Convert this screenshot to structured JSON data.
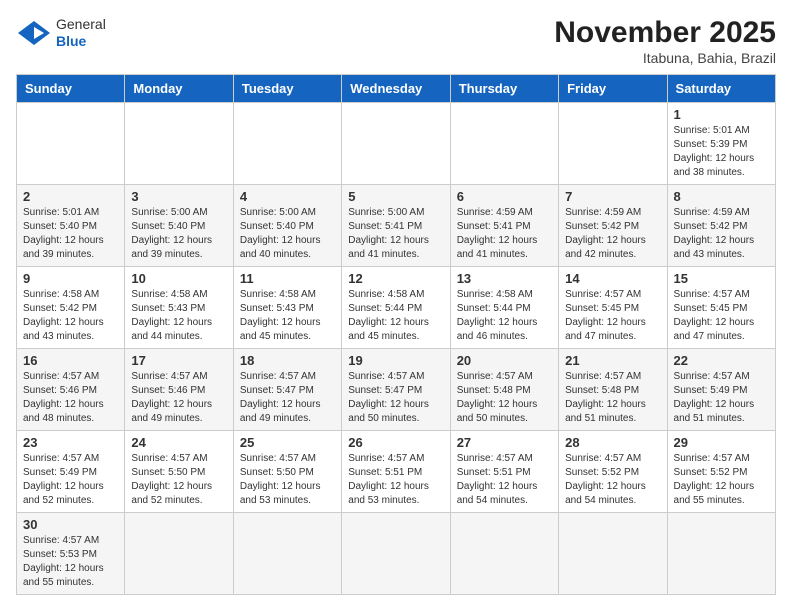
{
  "header": {
    "logo_general": "General",
    "logo_blue": "Blue",
    "month_title": "November 2025",
    "location": "Itabuna, Bahia, Brazil"
  },
  "weekdays": [
    "Sunday",
    "Monday",
    "Tuesday",
    "Wednesday",
    "Thursday",
    "Friday",
    "Saturday"
  ],
  "weeks": [
    [
      {
        "day": "",
        "info": ""
      },
      {
        "day": "",
        "info": ""
      },
      {
        "day": "",
        "info": ""
      },
      {
        "day": "",
        "info": ""
      },
      {
        "day": "",
        "info": ""
      },
      {
        "day": "",
        "info": ""
      },
      {
        "day": "1",
        "info": "Sunrise: 5:01 AM\nSunset: 5:39 PM\nDaylight: 12 hours\nand 38 minutes."
      }
    ],
    [
      {
        "day": "2",
        "info": "Sunrise: 5:01 AM\nSunset: 5:40 PM\nDaylight: 12 hours\nand 39 minutes."
      },
      {
        "day": "3",
        "info": "Sunrise: 5:00 AM\nSunset: 5:40 PM\nDaylight: 12 hours\nand 39 minutes."
      },
      {
        "day": "4",
        "info": "Sunrise: 5:00 AM\nSunset: 5:40 PM\nDaylight: 12 hours\nand 40 minutes."
      },
      {
        "day": "5",
        "info": "Sunrise: 5:00 AM\nSunset: 5:41 PM\nDaylight: 12 hours\nand 41 minutes."
      },
      {
        "day": "6",
        "info": "Sunrise: 4:59 AM\nSunset: 5:41 PM\nDaylight: 12 hours\nand 41 minutes."
      },
      {
        "day": "7",
        "info": "Sunrise: 4:59 AM\nSunset: 5:42 PM\nDaylight: 12 hours\nand 42 minutes."
      },
      {
        "day": "8",
        "info": "Sunrise: 4:59 AM\nSunset: 5:42 PM\nDaylight: 12 hours\nand 43 minutes."
      }
    ],
    [
      {
        "day": "9",
        "info": "Sunrise: 4:58 AM\nSunset: 5:42 PM\nDaylight: 12 hours\nand 43 minutes."
      },
      {
        "day": "10",
        "info": "Sunrise: 4:58 AM\nSunset: 5:43 PM\nDaylight: 12 hours\nand 44 minutes."
      },
      {
        "day": "11",
        "info": "Sunrise: 4:58 AM\nSunset: 5:43 PM\nDaylight: 12 hours\nand 45 minutes."
      },
      {
        "day": "12",
        "info": "Sunrise: 4:58 AM\nSunset: 5:44 PM\nDaylight: 12 hours\nand 45 minutes."
      },
      {
        "day": "13",
        "info": "Sunrise: 4:58 AM\nSunset: 5:44 PM\nDaylight: 12 hours\nand 46 minutes."
      },
      {
        "day": "14",
        "info": "Sunrise: 4:57 AM\nSunset: 5:45 PM\nDaylight: 12 hours\nand 47 minutes."
      },
      {
        "day": "15",
        "info": "Sunrise: 4:57 AM\nSunset: 5:45 PM\nDaylight: 12 hours\nand 47 minutes."
      }
    ],
    [
      {
        "day": "16",
        "info": "Sunrise: 4:57 AM\nSunset: 5:46 PM\nDaylight: 12 hours\nand 48 minutes."
      },
      {
        "day": "17",
        "info": "Sunrise: 4:57 AM\nSunset: 5:46 PM\nDaylight: 12 hours\nand 49 minutes."
      },
      {
        "day": "18",
        "info": "Sunrise: 4:57 AM\nSunset: 5:47 PM\nDaylight: 12 hours\nand 49 minutes."
      },
      {
        "day": "19",
        "info": "Sunrise: 4:57 AM\nSunset: 5:47 PM\nDaylight: 12 hours\nand 50 minutes."
      },
      {
        "day": "20",
        "info": "Sunrise: 4:57 AM\nSunset: 5:48 PM\nDaylight: 12 hours\nand 50 minutes."
      },
      {
        "day": "21",
        "info": "Sunrise: 4:57 AM\nSunset: 5:48 PM\nDaylight: 12 hours\nand 51 minutes."
      },
      {
        "day": "22",
        "info": "Sunrise: 4:57 AM\nSunset: 5:49 PM\nDaylight: 12 hours\nand 51 minutes."
      }
    ],
    [
      {
        "day": "23",
        "info": "Sunrise: 4:57 AM\nSunset: 5:49 PM\nDaylight: 12 hours\nand 52 minutes."
      },
      {
        "day": "24",
        "info": "Sunrise: 4:57 AM\nSunset: 5:50 PM\nDaylight: 12 hours\nand 52 minutes."
      },
      {
        "day": "25",
        "info": "Sunrise: 4:57 AM\nSunset: 5:50 PM\nDaylight: 12 hours\nand 53 minutes."
      },
      {
        "day": "26",
        "info": "Sunrise: 4:57 AM\nSunset: 5:51 PM\nDaylight: 12 hours\nand 53 minutes."
      },
      {
        "day": "27",
        "info": "Sunrise: 4:57 AM\nSunset: 5:51 PM\nDaylight: 12 hours\nand 54 minutes."
      },
      {
        "day": "28",
        "info": "Sunrise: 4:57 AM\nSunset: 5:52 PM\nDaylight: 12 hours\nand 54 minutes."
      },
      {
        "day": "29",
        "info": "Sunrise: 4:57 AM\nSunset: 5:52 PM\nDaylight: 12 hours\nand 55 minutes."
      }
    ],
    [
      {
        "day": "30",
        "info": "Sunrise: 4:57 AM\nSunset: 5:53 PM\nDaylight: 12 hours\nand 55 minutes."
      },
      {
        "day": "",
        "info": ""
      },
      {
        "day": "",
        "info": ""
      },
      {
        "day": "",
        "info": ""
      },
      {
        "day": "",
        "info": ""
      },
      {
        "day": "",
        "info": ""
      },
      {
        "day": "",
        "info": ""
      }
    ]
  ]
}
